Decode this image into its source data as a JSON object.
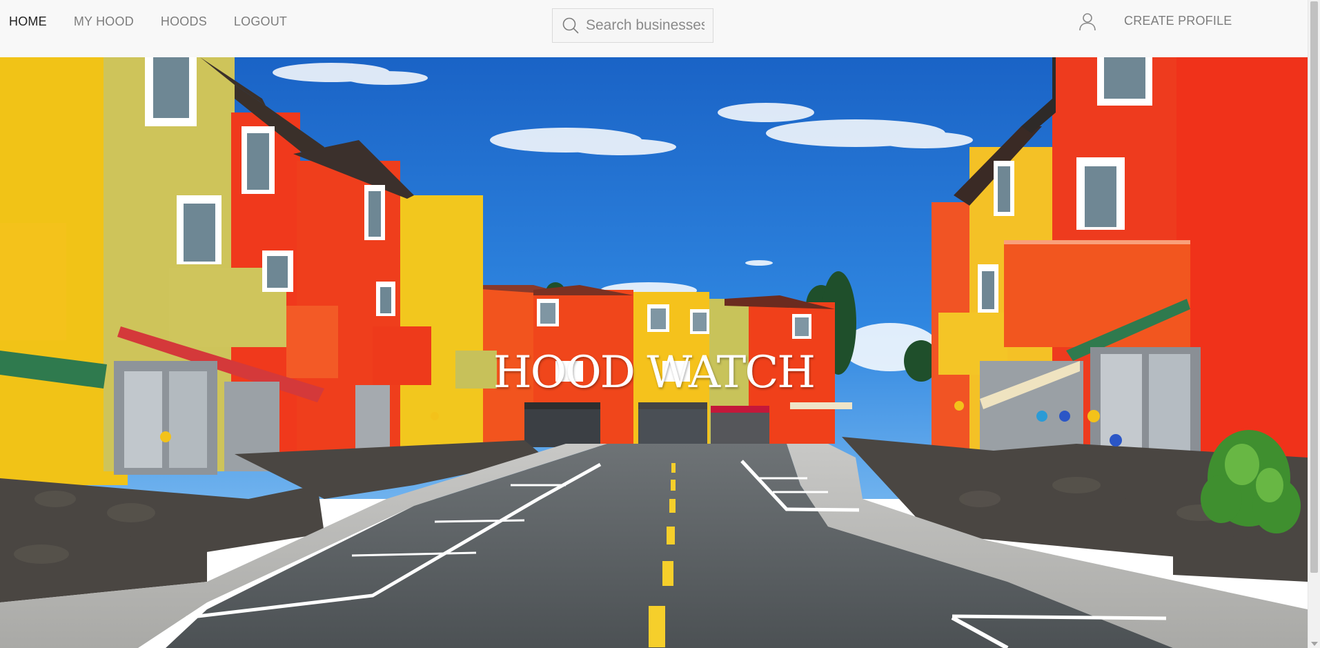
{
  "nav": {
    "links": [
      {
        "label": "HOME",
        "active": true
      },
      {
        "label": "MY HOOD",
        "active": false
      },
      {
        "label": "HOODS",
        "active": false
      },
      {
        "label": "LOGOUT",
        "active": false
      }
    ],
    "search": {
      "placeholder": "Search businesses",
      "value": "",
      "icon": "search-icon"
    },
    "user_icon": "user-icon",
    "create_profile_label": "CREATE PROFILE"
  },
  "hero": {
    "title": "HOOD WATCH",
    "image_subject": "colorful houses along a street under blue sky"
  },
  "colors": {
    "navbar_bg": "#f8f8f8",
    "nav_text": "#7d7d7d",
    "nav_active": "#222222",
    "sky": "#1f6fd0"
  }
}
